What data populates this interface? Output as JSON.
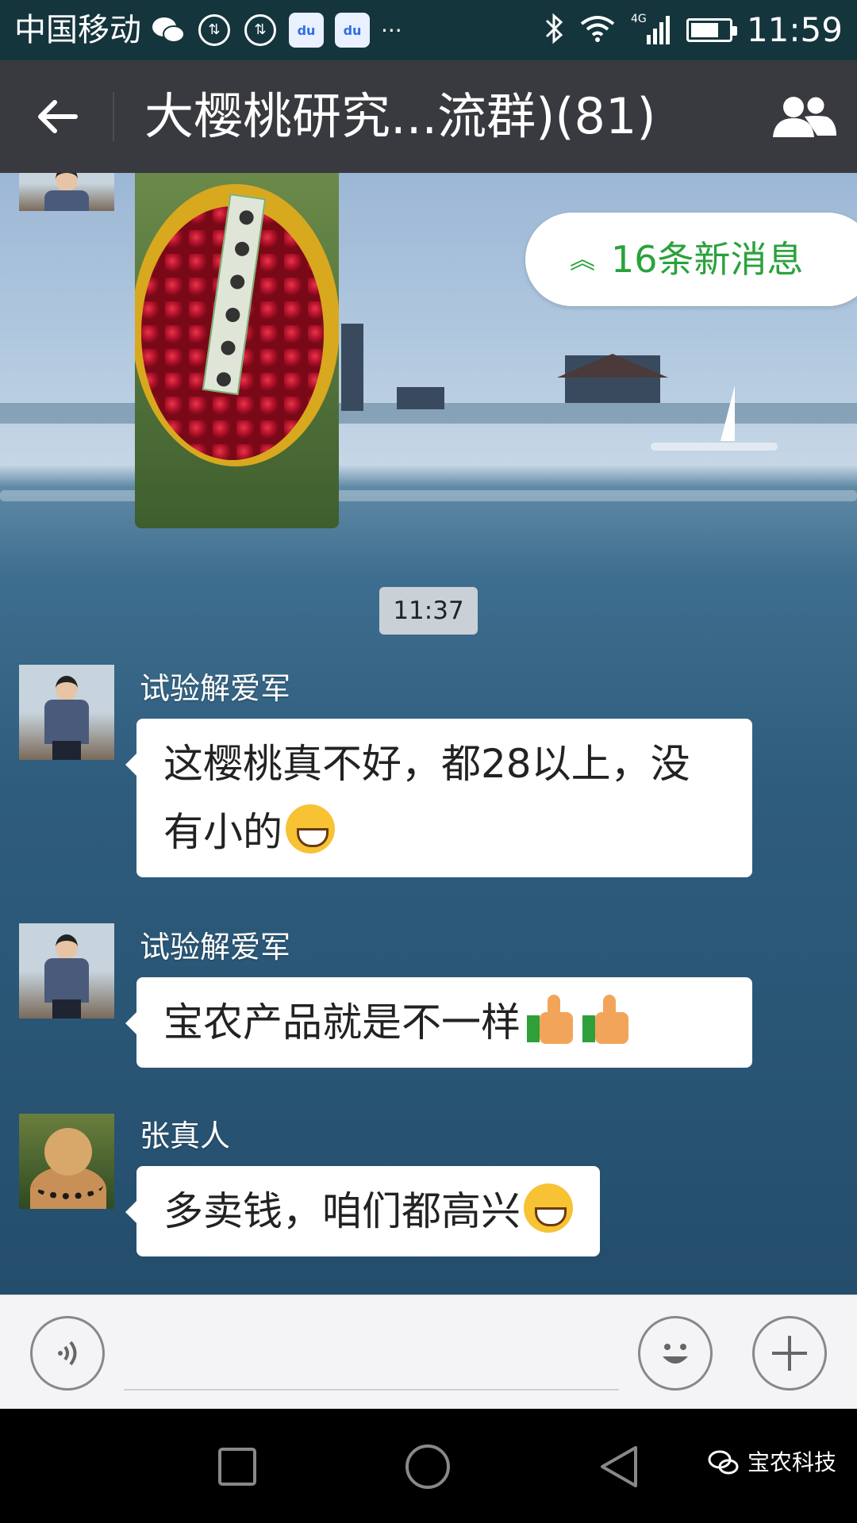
{
  "status_bar": {
    "carrier": "中国移动",
    "network": "4G",
    "time": "11:59",
    "icons": [
      "wechat-icon",
      "data-sync-icon",
      "data-sync-icon",
      "baidu-paw-icon",
      "baidu-paw-icon",
      "more-dots-icon",
      "bluetooth-icon",
      "wifi-icon",
      "signal-icon",
      "battery-icon"
    ],
    "battery_level": 0.75
  },
  "header": {
    "title": "大樱桃研究...流群)(81)",
    "back_icon": "back-arrow-icon",
    "members_icon": "group-members-icon"
  },
  "chat": {
    "new_messages": "16条新消息",
    "timestamp": "11:37",
    "messages": [
      {
        "sender": "试验解爱军",
        "text": "这樱桃真不好，都28以上，没有小的",
        "emoji": "grin-emoji"
      },
      {
        "sender": "试验解爱军",
        "text": "宝农产品就是不一样",
        "emoji": "thumbs-up-emoji"
      },
      {
        "sender": "张真人",
        "text": "多卖钱，咱们都高兴",
        "emoji": "grin-emoji"
      }
    ]
  },
  "input_bar": {
    "voice_icon": "voice-icon",
    "emoji_icon": "smiley-icon",
    "plus_icon": "plus-icon",
    "value": ""
  },
  "nav_bar": {
    "icons": [
      "recent-apps-icon",
      "home-icon",
      "back-triangle-icon"
    ]
  },
  "watermark": {
    "text": "宝农科技"
  },
  "colors": {
    "status_bar": "#15353d",
    "title_bar": "#393a3f",
    "accent_green": "#2aa23b",
    "bubble": "#ffffff"
  }
}
